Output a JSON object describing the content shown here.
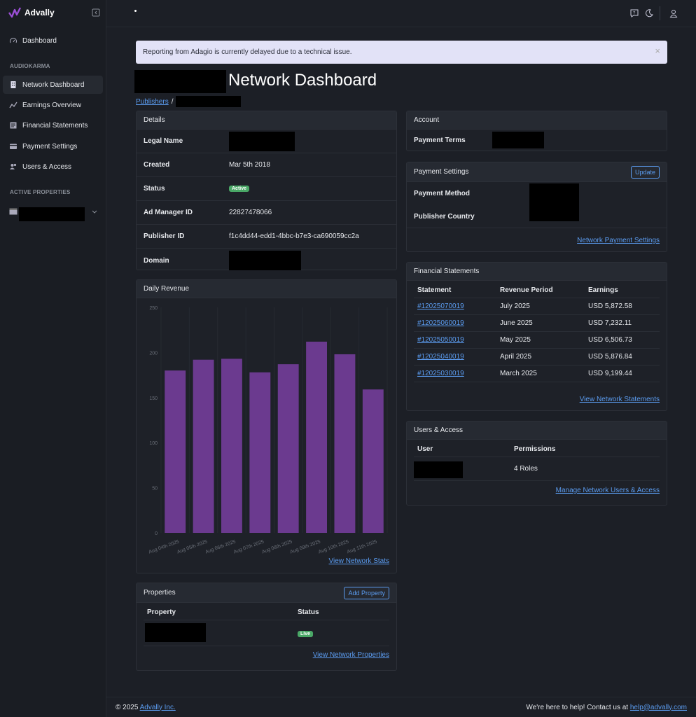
{
  "app": {
    "name": "Advally"
  },
  "sidebar": {
    "dashboard": "Dashboard",
    "section1": "AUDIOKARMA",
    "items": [
      {
        "label": "Network Dashboard",
        "icon": "building-icon"
      },
      {
        "label": "Earnings Overview",
        "icon": "trend-icon"
      },
      {
        "label": "Financial Statements",
        "icon": "document-icon"
      },
      {
        "label": "Payment Settings",
        "icon": "wallet-icon"
      },
      {
        "label": "Users & Access",
        "icon": "users-icon"
      }
    ],
    "section2": "ACTIVE PROPERTIES"
  },
  "alert": {
    "text": "Reporting from Adagio is currently delayed due to a technical issue.",
    "close": "×"
  },
  "header": {
    "title": "Network Dashboard",
    "crumb": "Publishers",
    "sep": "/"
  },
  "details": {
    "title": "Details",
    "legal_name": "Legal Name",
    "created_label": "Created",
    "created": "Mar 5th 2018",
    "status_label": "Status",
    "status": "Active",
    "ad_manager_label": "Ad Manager ID",
    "ad_manager": "22827478066",
    "publisher_id_label": "Publisher ID",
    "publisher_id": "f1c4dd44-edd1-4bbc-b7e3-ca690059cc2a",
    "domain_label": "Domain"
  },
  "revenue": {
    "title": "Daily Revenue",
    "link": "View Network Stats"
  },
  "chart_data": {
    "type": "bar",
    "title": "Daily Revenue",
    "categories": [
      "Aug 04th 2025",
      "Aug 05th 2025",
      "Aug 06th 2025",
      "Aug 07th 2025",
      "Aug 08th 2025",
      "Aug 09th 2025",
      "Aug 10th 2025",
      "Aug 11th 2025"
    ],
    "values": [
      180,
      192,
      193,
      178,
      187,
      212,
      198,
      159
    ],
    "ylim": [
      0,
      250
    ],
    "yticks": [
      0,
      50,
      100,
      150,
      200,
      250
    ],
    "color": "#6b3a8f",
    "grid": true
  },
  "properties": {
    "title": "Properties",
    "add": "Add Property",
    "col_property": "Property",
    "col_status": "Status",
    "status": "Live",
    "link": "View Network Properties"
  },
  "account": {
    "title": "Account",
    "payment_terms": "Payment Terms"
  },
  "payment": {
    "title": "Payment Settings",
    "update": "Update",
    "method": "Payment Method",
    "country": "Publisher Country",
    "link": "Network Payment Settings"
  },
  "statements": {
    "title": "Financial Statements",
    "col1": "Statement",
    "col2": "Revenue Period",
    "col3": "Earnings",
    "rows": [
      {
        "id": "#12025070019",
        "period": "July 2025",
        "earn": "USD 5,872.58"
      },
      {
        "id": "#12025060019",
        "period": "June 2025",
        "earn": "USD 7,232.11"
      },
      {
        "id": "#12025050019",
        "period": "May 2025",
        "earn": "USD 6,506.73"
      },
      {
        "id": "#12025040019",
        "period": "April 2025",
        "earn": "USD 5,876.84"
      },
      {
        "id": "#12025030019",
        "period": "March 2025",
        "earn": "USD 9,199.44"
      }
    ],
    "link": "View Network Statements"
  },
  "users": {
    "title": "Users & Access",
    "col_user": "User",
    "col_perm": "Permissions",
    "perm": "4 Roles",
    "link": "Manage Network Users & Access"
  },
  "footer": {
    "copy": "© 2025",
    "company": "Advally Inc.",
    "help": "We're here to help! Contact us at",
    "email": "help@advally.com"
  }
}
